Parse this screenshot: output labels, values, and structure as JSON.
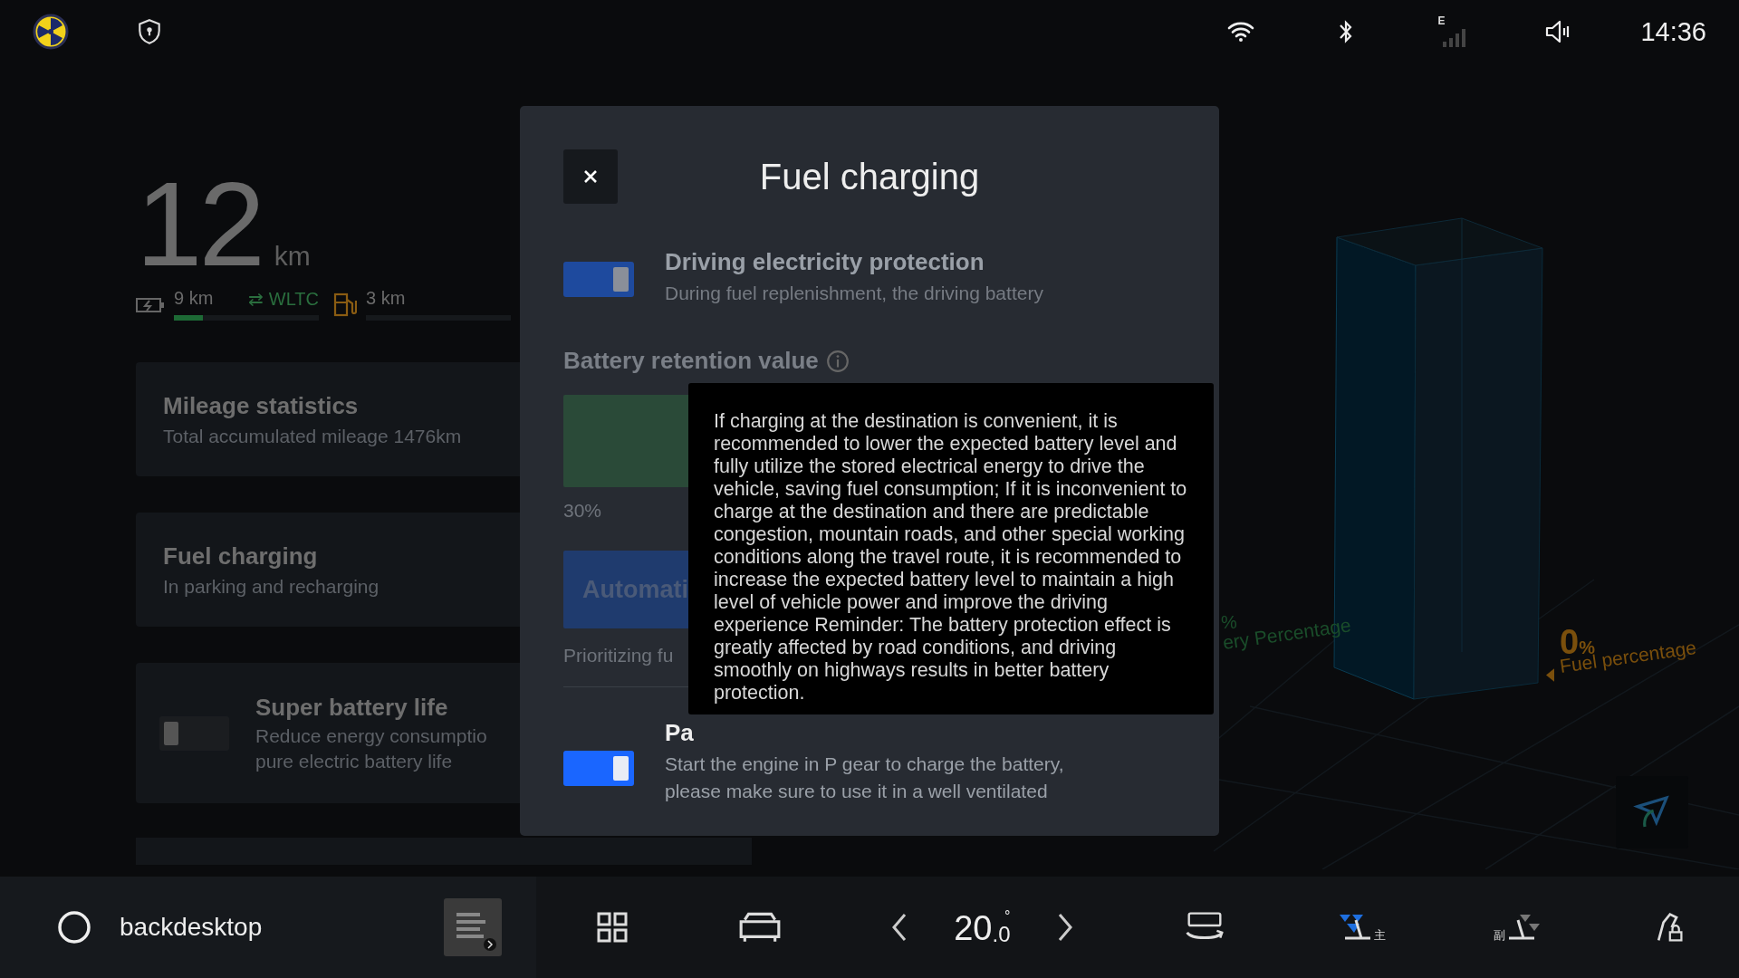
{
  "status_bar": {
    "signal_label": "E",
    "time": "14:36"
  },
  "range": {
    "value": "12",
    "unit": "km",
    "electric": {
      "text": "9 km",
      "level": 0.2
    },
    "cycle": "⇄ WLTC",
    "fuel": {
      "text": "3 km"
    }
  },
  "cards": [
    {
      "kind": "info",
      "title": "Mileage statistics",
      "lines": [
        "Total accumulated mileage 1476km"
      ]
    },
    {
      "kind": "info",
      "title": "Fuel charging",
      "lines": [
        "In parking and recharging"
      ]
    },
    {
      "kind": "toggle",
      "title": "Super battery life",
      "lines": [
        "Reduce energy consumptio",
        "pure electric battery life"
      ],
      "on": false
    }
  ],
  "modal": {
    "title": "Fuel charging",
    "settings": [
      {
        "title": "Driving electricity protection",
        "lines": [
          "During fuel replenishment, the driving battery"
        ],
        "on": true,
        "disabled": true
      }
    ],
    "retention": {
      "label": "Battery retention value",
      "reading": "30%",
      "button": "Automati",
      "hint": "Prioritizing fu"
    },
    "parking": {
      "title": "Pa",
      "lines": [
        "Start the engine in P gear to charge the battery,",
        "please make sure to use it in a well ventilated"
      ],
      "on": true,
      "disabled": false
    },
    "tooltip": "If charging at the destination is convenient, it is recommended to lower the expected battery level and fully utilize the stored electrical energy to drive the vehicle, saving fuel consumption; If it is inconvenient to charge at the destination and there are predictable congestion, mountain roads, and other special working conditions along the travel route, it is recommended to increase the expected battery level to maintain a high level of vehicle power and improve the driving experience Reminder: The battery protection effect is greatly affected by road conditions, and driving smoothly on highways results in better battery protection."
  },
  "gauges": {
    "battery": {
      "value": "%",
      "label": "ery Percentage"
    },
    "fuel": {
      "value": "0",
      "unit": "%",
      "label": "Fuel percentage"
    }
  },
  "bottom_bar": {
    "home_label": "backdesktop",
    "temperature": {
      "value": "20",
      "decimal": ".0",
      "unit": "°"
    },
    "driver_seat": "主",
    "passenger_seat": "副"
  }
}
